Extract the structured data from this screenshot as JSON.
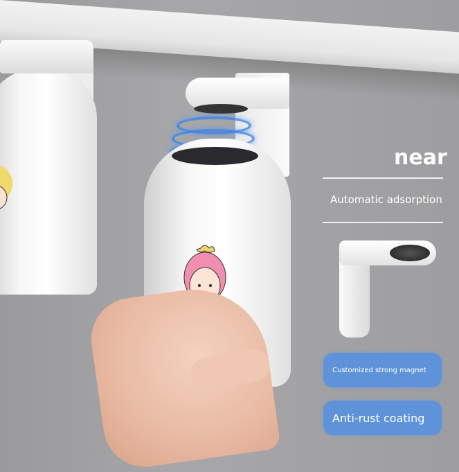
{
  "overlay": {
    "heading": "near",
    "subheading": "Automatic adsorption",
    "features": [
      "Customized strong magnet",
      "Anti-rust coating"
    ]
  },
  "colors": {
    "feature_pill": "#5f93d9",
    "wall": "#a3a3a5",
    "magnet_ring": "#3c82e6"
  }
}
